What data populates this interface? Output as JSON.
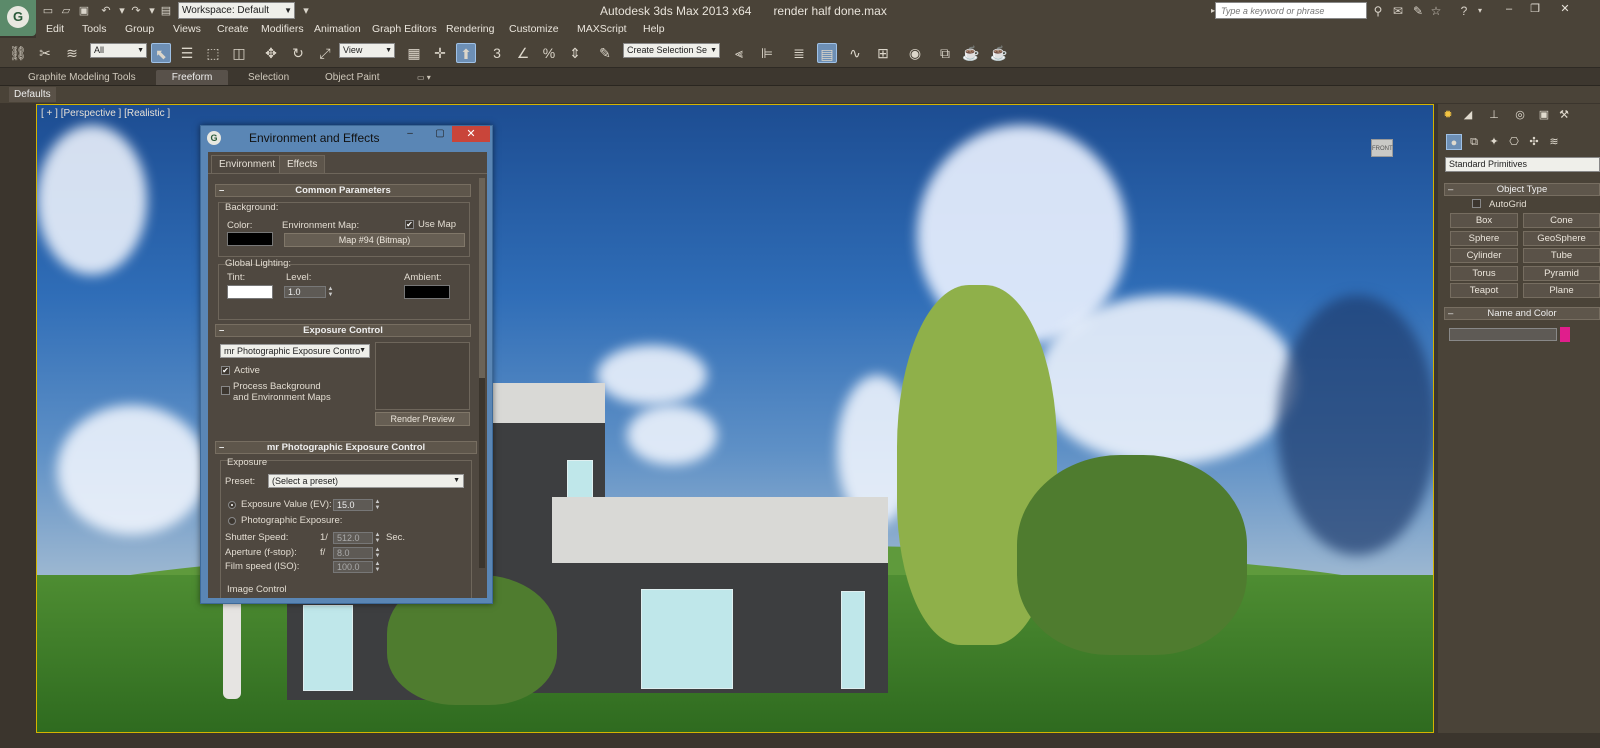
{
  "titlebar": {
    "workspace": "Workspace: Default",
    "app_name": "Autodesk 3ds Max  2013 x64",
    "file_name": "render half done.max",
    "search_placeholder": "Type a keyword or phrase"
  },
  "menu": [
    "Edit",
    "Tools",
    "Group",
    "Views",
    "Create",
    "Modifiers",
    "Animation",
    "Graph Editors",
    "Rendering",
    "Customize",
    "MAXScript",
    "Help"
  ],
  "toolbar": {
    "filter": "All",
    "coord_system": "View",
    "selection_set": "Create Selection Se",
    "snap_labels": [
      "3",
      "%"
    ]
  },
  "ribbon": {
    "tabs": [
      "Graphite Modeling Tools",
      "Freeform",
      "Selection",
      "Object Paint"
    ],
    "defaults": "Defaults"
  },
  "viewport": {
    "label": "[ + ] [Perspective ] [Realistic ]",
    "viewcube": "FRONT"
  },
  "dialog": {
    "title": "Environment and Effects",
    "tabs": [
      "Environment",
      "Effects"
    ],
    "common": {
      "header": "Common Parameters",
      "background": "Background:",
      "color": "Color:",
      "env_map": "Environment Map:",
      "use_map": "Use Map",
      "map_button": "Map #94 (Bitmap)",
      "global_lighting": "Global Lighting:",
      "tint": "Tint:",
      "level": "Level:",
      "level_value": "1.0",
      "ambient": "Ambient:"
    },
    "exposure": {
      "header": "Exposure Control",
      "type": "mr Photographic Exposure Contro",
      "active": "Active",
      "process_bg_1": "Process Background",
      "process_bg_2": "and Environment Maps",
      "render_preview": "Render Preview"
    },
    "mr": {
      "header": "mr Photographic Exposure Control",
      "group": "Exposure",
      "preset_label": "Preset:",
      "preset_value": "(Select a preset)",
      "ev_label": "Exposure Value (EV):",
      "ev_value": "15.0",
      "photographic": "Photographic Exposure:",
      "shutter_label": "Shutter Speed:",
      "shutter_prefix": "1/",
      "shutter_value": "512.0",
      "shutter_unit": "Sec.",
      "aperture_label": "Aperture (f-stop):",
      "aperture_prefix": "f/",
      "aperture_value": "8.0",
      "film_label": "Film speed (ISO):",
      "film_value": "100.0",
      "image_control": "Image Control"
    }
  },
  "command_panel": {
    "category": "Standard Primitives",
    "object_type": "Object Type",
    "autogrid": "AutoGrid",
    "buttons": [
      "Box",
      "Cone",
      "Sphere",
      "GeoSphere",
      "Cylinder",
      "Tube",
      "Torus",
      "Pyramid",
      "Teapot",
      "Plane"
    ],
    "name_and_color": "Name and Color"
  },
  "colors": {
    "accent_blue": "#6d8fb5",
    "dialog_frame": "#5a86b5",
    "close_red": "#c9453a",
    "object_color": "#e01e8c",
    "viewport_border": "#d4b400"
  }
}
